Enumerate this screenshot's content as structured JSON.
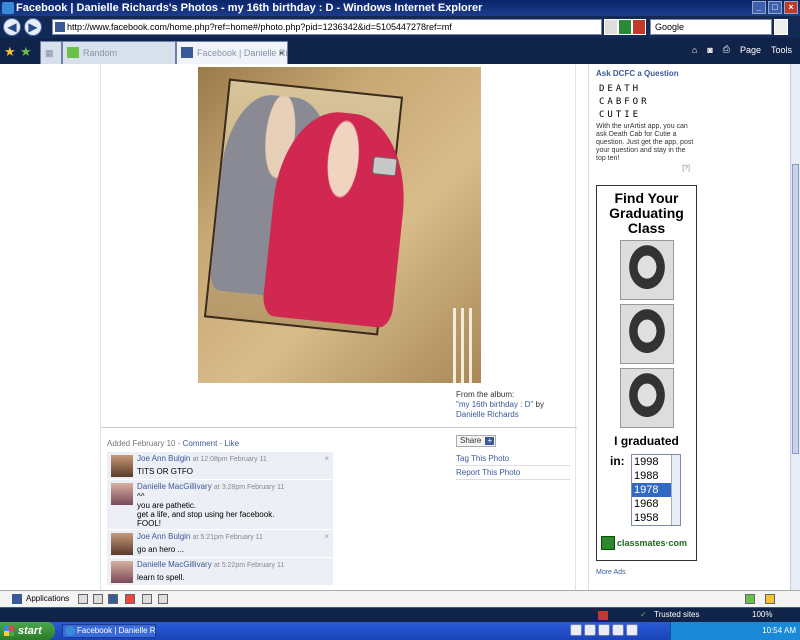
{
  "window": {
    "title": "Facebook | Danielle Richards's Photos - my 16th birthday : D - Windows Internet Explorer"
  },
  "browser": {
    "url": "http://www.facebook.com/home.php?ref=home#/photo.php?pid=1236342&id=5105447278ref=mf",
    "search_placeholder": "Google",
    "tabs": [
      {
        "label": "Random"
      },
      {
        "label": "Facebook | Danielle Richa..."
      }
    ],
    "tools": {
      "page_label": "Page",
      "tools_label": "Tools"
    }
  },
  "photo": {
    "album_prefix": "From the album:",
    "album_name": "\"my 16th birthday : D\"",
    "by": "by",
    "author": "Danielle Richards"
  },
  "actions": {
    "added": "Added February 10",
    "comment_link": "Comment",
    "like_link": "Like",
    "sep": " - ",
    "share": "Share",
    "tag_photo": "Tag This Photo",
    "report_photo": "Report This Photo"
  },
  "comments": [
    {
      "name": "Joe Ann Bulgin",
      "time": "at 12:08pm February 11",
      "lines": [
        "TITS OR GTFO"
      ],
      "removable": true
    },
    {
      "name": "Danielle MacGillivary",
      "time": "at 3:28pm February 11",
      "lines": [
        "^^",
        "you are pathetic.",
        "get a life, and stop using her facebook.",
        "FOOL!"
      ],
      "removable": false
    },
    {
      "name": "Joe Ann Bulgin",
      "time": "at 5:21pm February 11",
      "lines": [
        "go an hero ..."
      ],
      "removable": true
    },
    {
      "name": "Danielle MacGillivary",
      "time": "at 5:22pm February 11",
      "lines": [
        "learn to spell."
      ],
      "removable": false
    }
  ],
  "sidebar": {
    "ask_title": "Ask DCFC a Question",
    "dcfc_lines": [
      "DEATH",
      "CABFOR",
      "CUTIE"
    ],
    "ask_text": "With the urArtist app, you can ask Death Cab for Cutie a question. Just get the app, post your question and stay in the top ten!",
    "help": "[?]",
    "ad": {
      "headline": "Find Your Graduating Class",
      "graduated": "I graduated",
      "in_label": "in:",
      "years": [
        "1998",
        "1988",
        "1978",
        "1968",
        "1958"
      ],
      "selected_year": "1978",
      "brand": "classmates·com"
    },
    "more_ads": "More Ads"
  },
  "fb_bar": {
    "applications": "Applications"
  },
  "status": {
    "zone": "Trusted sites",
    "zoom": "100%"
  },
  "taskbar": {
    "start": "start",
    "task_label": "Facebook | Danielle R...",
    "clock": "10:54 AM"
  }
}
